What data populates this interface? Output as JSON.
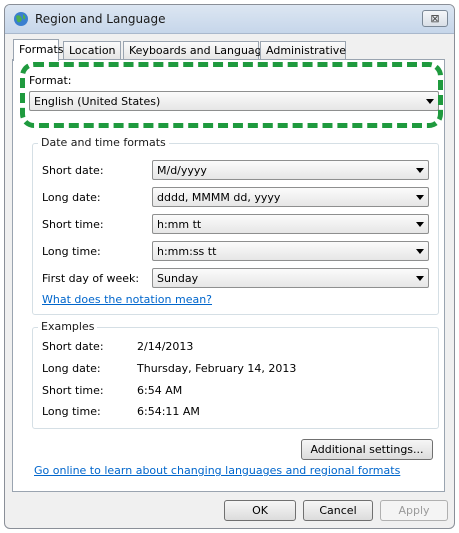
{
  "window": {
    "title": "Region and Language",
    "close_glyph": "⊠"
  },
  "tabs": [
    {
      "label": "Formats"
    },
    {
      "label": "Location"
    },
    {
      "label": "Keyboards and Languages"
    },
    {
      "label": "Administrative"
    }
  ],
  "format": {
    "label": "Format:",
    "value": "English (United States)"
  },
  "date_time": {
    "legend": "Date and time formats",
    "rows": [
      {
        "label": "Short date:",
        "value": "M/d/yyyy"
      },
      {
        "label": "Long date:",
        "value": "dddd, MMMM dd, yyyy"
      },
      {
        "label": "Short time:",
        "value": "h:mm tt"
      },
      {
        "label": "Long time:",
        "value": "h:mm:ss tt"
      },
      {
        "label": "First day of week:",
        "value": "Sunday"
      }
    ],
    "notation_link": "What does the notation mean?"
  },
  "examples": {
    "legend": "Examples",
    "rows": [
      {
        "label": "Short date:",
        "value": "2/14/2013"
      },
      {
        "label": "Long date:",
        "value": "Thursday, February 14, 2013"
      },
      {
        "label": "Short time:",
        "value": "6:54 AM"
      },
      {
        "label": "Long time:",
        "value": "6:54:11 AM"
      }
    ]
  },
  "additional_settings": "Additional settings...",
  "online_link": "Go online to learn about changing languages and regional formats",
  "footer": {
    "ok": "OK",
    "cancel": "Cancel",
    "apply": "Apply"
  },
  "colors": {
    "highlight_ring": "#1f9a3e",
    "link": "#0066cc"
  }
}
